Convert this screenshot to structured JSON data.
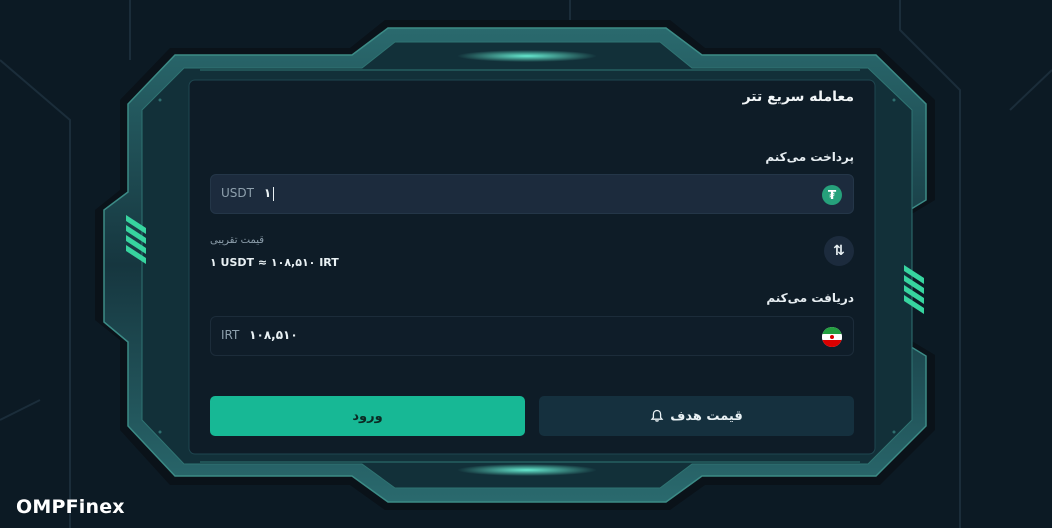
{
  "title": "معامله سریع تتر",
  "pay": {
    "label": "پرداخت می‌کنم",
    "unit": "USDT",
    "amount": "۱",
    "coin_icon": "tether-icon"
  },
  "swap": {
    "icon": "swap-arrows-icon",
    "glyph": "⇅"
  },
  "rate": {
    "hint": "قیمت تقریبی",
    "value": "۱ USDT ≈ ۱۰۸,۵۱۰ IRT"
  },
  "receive": {
    "label": "دریافت می‌کنم",
    "unit": "IRT",
    "amount": "۱۰۸,۵۱۰",
    "coin_icon": "iran-flag-icon"
  },
  "buttons": {
    "login": "ورود",
    "target_price": "قیمت هدف"
  },
  "brand": {
    "logo": "OMPFinex"
  },
  "colors": {
    "accent": "#17b895",
    "background": "#0c1a24",
    "panel": "#0e1c27",
    "input": "#1c2b3d",
    "frame": "#1f4d55",
    "stripes": "#37d49f"
  }
}
